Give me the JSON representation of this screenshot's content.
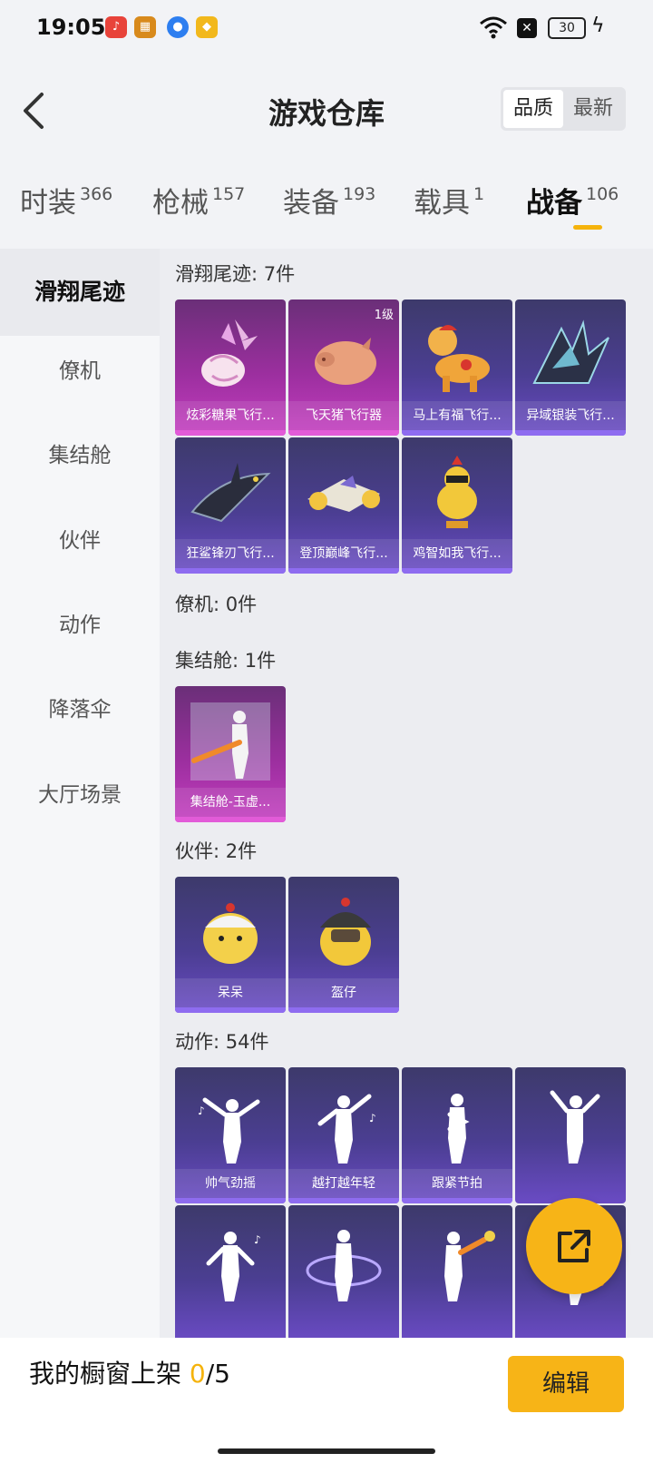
{
  "status_bar": {
    "time": "19:05",
    "battery": "30"
  },
  "header": {
    "title": "游戏仓库",
    "sort_options": [
      "品质",
      "最新"
    ],
    "active_sort": 0
  },
  "tabs": [
    {
      "label": "时装",
      "count": "366"
    },
    {
      "label": "枪械",
      "count": "157"
    },
    {
      "label": "装备",
      "count": "193"
    },
    {
      "label": "载具",
      "count": "1"
    },
    {
      "label": "战备",
      "count": "106"
    }
  ],
  "active_tab": 4,
  "sidebar": {
    "items": [
      "滑翔尾迹",
      "僚机",
      "集结舱",
      "伙伴",
      "动作",
      "降落伞",
      "大厅场景"
    ],
    "active": 0
  },
  "sections": {
    "glide": {
      "title": "滑翔尾迹: 7件",
      "items": [
        {
          "name": "炫彩糖果飞行...",
          "level": ""
        },
        {
          "name": "飞天猪飞行器",
          "level": "1级"
        },
        {
          "name": "马上有福飞行..."
        },
        {
          "name": "异域银装飞行..."
        },
        {
          "name": "狂鲨锋刃飞行..."
        },
        {
          "name": "登顶巅峰飞行..."
        },
        {
          "name": "鸡智如我飞行..."
        }
      ]
    },
    "wingman": {
      "title": "僚机: 0件"
    },
    "pod": {
      "title": "集结舱: 1件",
      "items": [
        {
          "name": "集结舱-玉虚..."
        }
      ]
    },
    "partner": {
      "title": "伙伴: 2件",
      "items": [
        {
          "name": "呆呆"
        },
        {
          "name": "盔仔"
        }
      ]
    },
    "emote": {
      "title": "动作: 54件",
      "items": [
        {
          "name": "帅气劲摇"
        },
        {
          "name": "越打越年轻"
        },
        {
          "name": "跟紧节拍"
        }
      ]
    }
  },
  "bottom": {
    "label": "我的橱窗上架 ",
    "current": "0",
    "total": "/5",
    "edit_label": "编辑"
  }
}
